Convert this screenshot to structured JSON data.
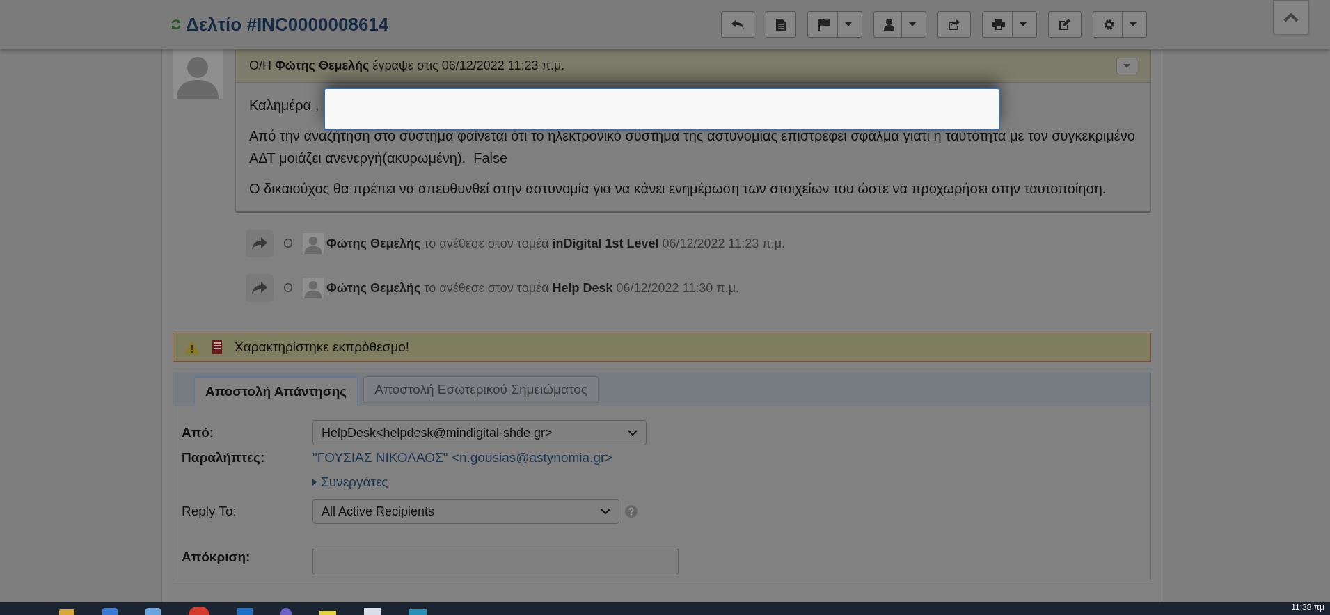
{
  "header": {
    "title": "Δελτίο #INC0000008614"
  },
  "message": {
    "author_line": "Ο/Η **Φώτης Θεμελής** έγραψε στις 06/12/2022 11:23 π.μ.",
    "body": [
      "Καλημέρα ,",
      "Από την αναζήτηση στο σύστημα φαίνεται ότι το ηλεκτρονικό σύστημα της αστυνομίας επιστρέφει σφάλμα γιατί η ταυτότητα με τον συγκεκριμένο ΑΔΤ μοιάζει ανενεργή(ακυρωμένη).  False",
      "Ο δικαιούχος θα πρέπει να απευθυνθεί στην αστυνομία για να κάνει ενημέρωση των στοιχείων του ώστε να προχωρήσει στην ταυτοποίηση."
    ]
  },
  "events": [
    {
      "prefix": "Ο",
      "text": "**Φώτης Θεμελής** το ανέθεσε στον τομέα **inDigital 1st Level** 06/12/2022 11:23 π.μ."
    },
    {
      "prefix": "Ο",
      "text": "**Φώτης Θεμελής** το ανέθεσε στον τομέα **Help Desk** 06/12/2022 11:30 π.μ."
    }
  ],
  "alert": "Χαρακτηρίστηκε εκπρόθεσμο!",
  "tabs": [
    {
      "label": "Αποστολή Απάντησης",
      "selected": true
    },
    {
      "label": "Αποστολή Εσωτερικού Σημειώματος",
      "selected": false
    }
  ],
  "form": {
    "from": {
      "label": "Από:",
      "value": "HelpDesk<helpdesk@mindigital-shde.gr>"
    },
    "recipients": {
      "label": "Παραλήπτες:",
      "value": "\"ΓΟΥΣΙΑΣ ΝΙΚΟΛΑΟΣ\" <n.gousias@astynomia.gr>"
    },
    "collaborators": "Συνεργάτες",
    "reply_to": {
      "label": "Reply To:",
      "value": "All Active Recipients"
    },
    "response": {
      "label": "Απόκριση:"
    }
  },
  "taskbar": {
    "clock": "11:38 πμ"
  }
}
